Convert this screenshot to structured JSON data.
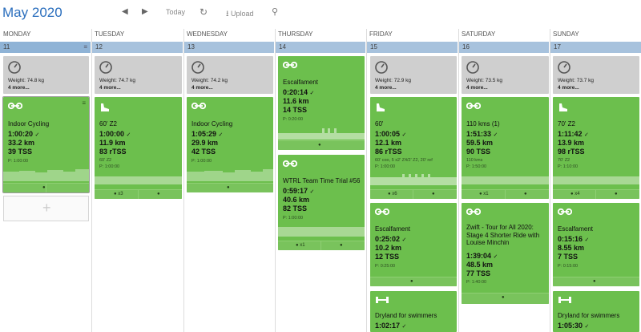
{
  "header": {
    "month": "May",
    "year": "2020",
    "today_label": "Today",
    "upload_label": "Upload"
  },
  "days": [
    "MONDAY",
    "TUESDAY",
    "WEDNESDAY",
    "THURSDAY",
    "FRIDAY",
    "SATURDAY",
    "SUNDAY"
  ],
  "dates": [
    "11",
    "12",
    "13",
    "14",
    "15",
    "16",
    "17"
  ],
  "weights": {
    "mon": {
      "weight": "Weight: 74.8 kg",
      "more": "4 more..."
    },
    "tue": {
      "weight": "Weight: 74.7 kg",
      "more": "4 more..."
    },
    "wed": {
      "weight": "Weight: 74.2 kg",
      "more": "4 more..."
    },
    "fri": {
      "weight": "Weight: 72.9 kg",
      "more": "4 more..."
    },
    "sat": {
      "weight": "Weight: 73.5 kg",
      "more": "4 more..."
    },
    "sun": {
      "weight": "Weight: 73.7 kg",
      "more": "4 more..."
    }
  },
  "workouts": {
    "mon_indoor": {
      "title": "Indoor Cycling",
      "time": "1:00:20",
      "dist": "33.2 km",
      "load": "39 TSS",
      "plan": "P: 1:00:00"
    },
    "tue_run": {
      "title": "60' Z2",
      "time": "1:00:00",
      "dist": "11.9 km",
      "load": "83 rTSS",
      "desc": "60' Z2",
      "plan": "P: 1:00:00",
      "count": "x3"
    },
    "wed_indoor": {
      "title": "Indoor Cycling",
      "time": "1:05:29",
      "dist": "29.9 km",
      "load": "42 TSS",
      "plan": "P: 1:00:00"
    },
    "thu_escal": {
      "title": "Escalfament",
      "time": "0:20:14",
      "dist": "11.6 km",
      "load": "14 TSS",
      "plan": "P: 0:20:00"
    },
    "thu_wtrl": {
      "title": "WTRL Team Time Trial #56",
      "time": "0:59:17",
      "dist": "40.6 km",
      "load": "82 TSS",
      "plan": "P: 1:00:00",
      "count": "x1"
    },
    "fri_run": {
      "title": "60'",
      "time": "1:00:05",
      "dist": "12.1 km",
      "load": "86 rTSS",
      "desc": "60' coo, 5 x2' Z4/2' Z2, 20' ref",
      "plan": "P: 1:00:00",
      "count": "x6"
    },
    "fri_escal": {
      "title": "Escalfament",
      "time": "0:25:02",
      "dist": "10.2 km",
      "load": "12 TSS",
      "plan": "P: 0:25:00"
    },
    "fri_dry": {
      "title": "Dryland for swimmers",
      "time": "1:02:17"
    },
    "sat_ride": {
      "title": "110 kms (1)",
      "time": "1:51:33",
      "dist": "59.5 km",
      "load": "90 TSS",
      "desc": "110 kms",
      "plan": "P: 1:50:00",
      "count": "x1"
    },
    "sat_zwift": {
      "title": "Zwift - Tour for All 2020: Stage 4 Shorter Ride with Louise Minchin",
      "time": "1:39:04",
      "dist": "48.5 km",
      "load": "77 TSS",
      "plan": "P: 1:40:00"
    },
    "sun_run": {
      "title": "70' Z2",
      "time": "1:11:42",
      "dist": "13.9 km",
      "load": "98 rTSS",
      "desc": "70' Z2",
      "plan": "P: 1:10:00",
      "count": "x4"
    },
    "sun_escal": {
      "title": "Escalfament",
      "time": "0:15:16",
      "dist": "8.55 km",
      "load": "7 TSS",
      "plan": "P: 0:15:00"
    },
    "sun_dry": {
      "title": "Dryland for swimmers",
      "time": "1:05:30"
    }
  },
  "icons": {
    "weight": "scale-icon",
    "bike": "bike-icon",
    "run": "shoe-icon",
    "strength": "dumbbell-icon",
    "comment": "comment-icon",
    "kettlebell": "kettlebell-icon"
  },
  "colors": {
    "accent": "#2a6ebd",
    "workout_green": "#6cbf4d",
    "metric_grey": "#cfcfcf",
    "datebar": "#a7c2dd"
  }
}
